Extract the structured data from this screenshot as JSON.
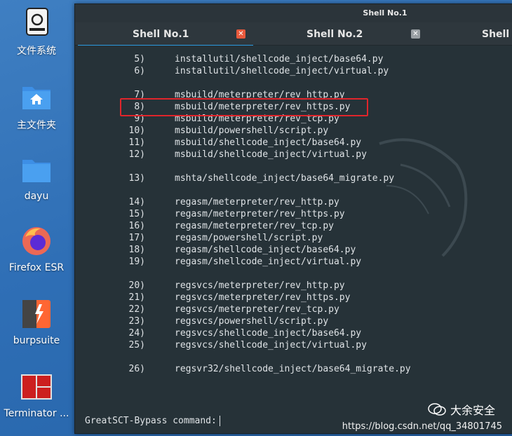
{
  "desktop": {
    "icons": [
      {
        "label": "文件系统",
        "icon": "drive-icon"
      },
      {
        "label": "主文件夹",
        "icon": "home-folder-icon"
      },
      {
        "label": "dayu",
        "icon": "folder-icon"
      },
      {
        "label": "Firefox ESR",
        "icon": "firefox-icon"
      },
      {
        "label": "burpsuite",
        "icon": "burpsuite-icon"
      },
      {
        "label": "Terminator ...",
        "icon": "terminator-icon"
      }
    ]
  },
  "window": {
    "title": "Shell No.1",
    "tabs": [
      {
        "label": "Shell No.1",
        "active": true
      },
      {
        "label": "Shell No.2",
        "active": false
      },
      {
        "label": "Shell N",
        "active": false
      }
    ]
  },
  "terminal": {
    "lines": [
      {
        "num": "5)",
        "path": "installutil/shellcode_inject/base64.py"
      },
      {
        "num": "6)",
        "path": "installutil/shellcode_inject/virtual.py"
      },
      {
        "num": "",
        "path": ""
      },
      {
        "num": "7)",
        "path": "msbuild/meterpreter/rev_http.py"
      },
      {
        "num": "8)",
        "path": "msbuild/meterpreter/rev_https.py"
      },
      {
        "num": "9)",
        "path": "msbuild/meterpreter/rev_tcp.py"
      },
      {
        "num": "10)",
        "path": "msbuild/powershell/script.py"
      },
      {
        "num": "11)",
        "path": "msbuild/shellcode_inject/base64.py"
      },
      {
        "num": "12)",
        "path": "msbuild/shellcode_inject/virtual.py"
      },
      {
        "num": "",
        "path": ""
      },
      {
        "num": "13)",
        "path": "mshta/shellcode_inject/base64_migrate.py"
      },
      {
        "num": "",
        "path": ""
      },
      {
        "num": "14)",
        "path": "regasm/meterpreter/rev_http.py"
      },
      {
        "num": "15)",
        "path": "regasm/meterpreter/rev_https.py"
      },
      {
        "num": "16)",
        "path": "regasm/meterpreter/rev_tcp.py"
      },
      {
        "num": "17)",
        "path": "regasm/powershell/script.py"
      },
      {
        "num": "18)",
        "path": "regasm/shellcode_inject/base64.py"
      },
      {
        "num": "19)",
        "path": "regasm/shellcode_inject/virtual.py"
      },
      {
        "num": "",
        "path": ""
      },
      {
        "num": "20)",
        "path": "regsvcs/meterpreter/rev_http.py"
      },
      {
        "num": "21)",
        "path": "regsvcs/meterpreter/rev_https.py"
      },
      {
        "num": "22)",
        "path": "regsvcs/meterpreter/rev_tcp.py"
      },
      {
        "num": "23)",
        "path": "regsvcs/powershell/script.py"
      },
      {
        "num": "24)",
        "path": "regsvcs/shellcode_inject/base64.py"
      },
      {
        "num": "25)",
        "path": "regsvcs/shellcode_inject/virtual.py"
      },
      {
        "num": "",
        "path": ""
      },
      {
        "num": "26)",
        "path": "regsvr32/shellcode_inject/base64_migrate.py"
      }
    ],
    "prompt": "GreatSCT-Bypass command:"
  },
  "watermarks": {
    "brand": "大余安全",
    "url": "https://blog.csdn.net/qq_34801745"
  },
  "colors": {
    "highlight": "#e0252b",
    "tab_accent": "#2b9ae0",
    "terminal_bg": "#263238"
  }
}
